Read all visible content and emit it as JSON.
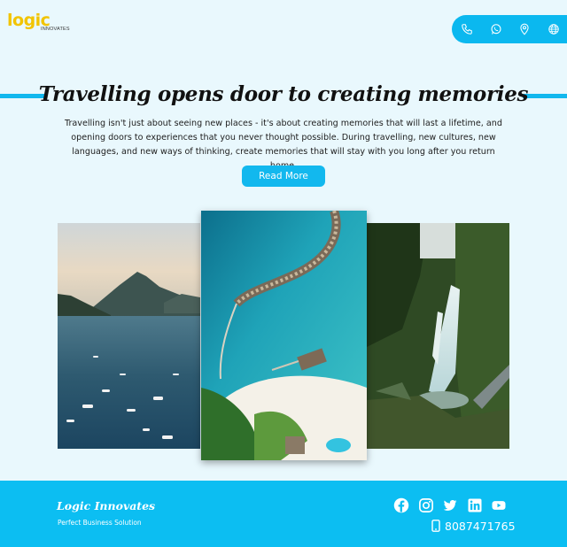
{
  "header": {
    "logo_text": "logic",
    "logo_subtext": "INNOVATES",
    "contact_icons": [
      "phone-icon",
      "whatsapp-icon",
      "location-pin-icon",
      "globe-icon"
    ]
  },
  "hero": {
    "headline": "Travelling opens door to creating memories",
    "paragraph": "Travelling isn't just about seeing new places - it's about creating memories that will last a lifetime, and opening doors to experiences that you never thought possible. During travelling, new cultures, new languages, and new ways of thinking, create memories that will stay with you long after you return home.",
    "read_more_label": "Read More"
  },
  "gallery": {
    "images": [
      "coastal-bay-photo",
      "overwater-villas-photo",
      "waterfall-jungle-photo"
    ]
  },
  "footer": {
    "brand": "Logic Innovates",
    "tagline": "Perfect Business Solution",
    "social_icons": [
      "facebook-icon",
      "instagram-icon",
      "twitter-icon",
      "linkedin-icon",
      "youtube-icon"
    ],
    "phone": "8087471765"
  },
  "colors": {
    "accent": "#12b8ee",
    "background": "#e9f8fd",
    "logo_yellow": "#f2c400"
  }
}
